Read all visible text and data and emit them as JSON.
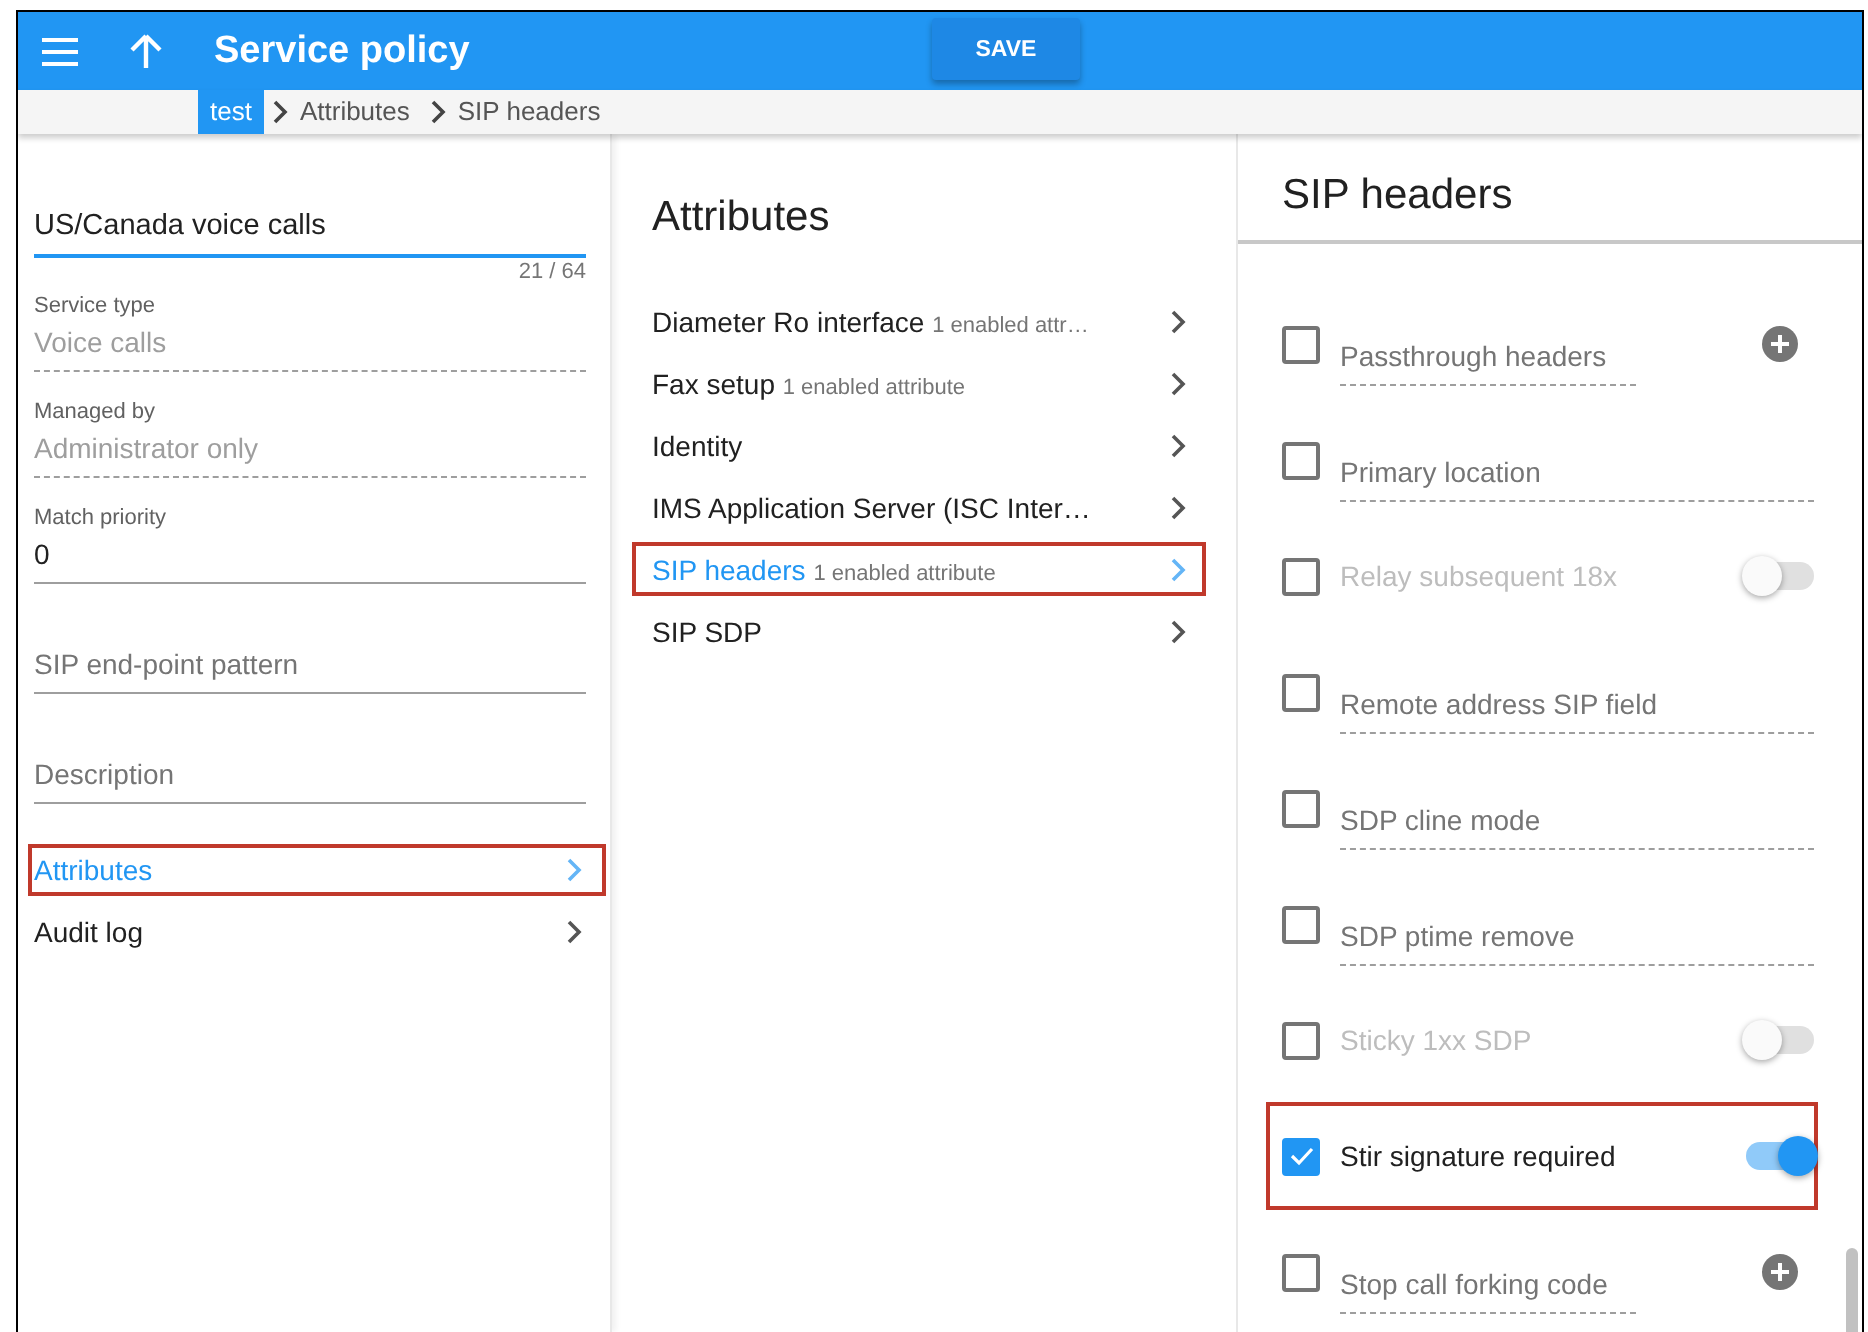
{
  "header": {
    "title": "Service policy",
    "save_button": "SAVE"
  },
  "breadcrumbs": [
    {
      "label": "test",
      "selected": true
    },
    {
      "label": "Attributes",
      "selected": false
    },
    {
      "label": "SIP headers",
      "selected": false
    }
  ],
  "form": {
    "name": {
      "value": "US/Canada voice calls",
      "counter": "21 / 64",
      "focused": true
    },
    "fields": [
      {
        "kind": "readonly",
        "label": "Service type",
        "value": "Voice calls"
      },
      {
        "kind": "readonly",
        "label": "Managed by",
        "value": "Administrator only"
      },
      {
        "kind": "input",
        "label": "Match priority",
        "value": "0"
      },
      {
        "kind": "empty",
        "placeholder": "SIP end-point pattern"
      },
      {
        "kind": "empty",
        "placeholder": "Description"
      }
    ],
    "nav": [
      {
        "label": "Attributes",
        "selected": true,
        "highlighted": true
      },
      {
        "label": "Audit log",
        "selected": false,
        "highlighted": false
      }
    ]
  },
  "attributes": {
    "title": "Attributes",
    "items": [
      {
        "label": "Diameter Ro interface",
        "note": "1 enabled attr…",
        "selected": false,
        "highlighted": false
      },
      {
        "label": "Fax setup",
        "note": "1 enabled attribute",
        "selected": false,
        "highlighted": false
      },
      {
        "label": "Identity",
        "selected": false,
        "highlighted": false
      },
      {
        "label": "IMS Application Server (ISC Inter…",
        "selected": false,
        "highlighted": false
      },
      {
        "label": "SIP headers",
        "note": "1 enabled attribute",
        "selected": true,
        "highlighted": true
      },
      {
        "label": "SIP SDP",
        "selected": false,
        "highlighted": false
      }
    ]
  },
  "sip_headers": {
    "title": "SIP headers",
    "items": [
      {
        "kind": "select",
        "label": "Passthrough headers",
        "checked": false,
        "add_button": true,
        "highlighted": false
      },
      {
        "kind": "select",
        "label": "Primary location",
        "checked": false,
        "add_button": false,
        "highlighted": false
      },
      {
        "kind": "toggle",
        "label": "Relay subsequent 18x",
        "checked": false,
        "on": false,
        "highlighted": false
      },
      {
        "kind": "select",
        "label": "Remote address SIP field",
        "checked": false,
        "add_button": false,
        "highlighted": false
      },
      {
        "kind": "select",
        "label": "SDP cline mode",
        "checked": false,
        "add_button": false,
        "highlighted": false
      },
      {
        "kind": "select",
        "label": "SDP ptime remove",
        "checked": false,
        "add_button": false,
        "highlighted": false
      },
      {
        "kind": "toggle",
        "label": "Sticky 1xx SDP",
        "checked": false,
        "on": false,
        "highlighted": false
      },
      {
        "kind": "toggle",
        "label": "Stir signature required",
        "checked": true,
        "on": true,
        "highlighted": true
      },
      {
        "kind": "select",
        "label": "Stop call forking code",
        "checked": false,
        "add_button": true,
        "highlighted": false
      }
    ]
  }
}
